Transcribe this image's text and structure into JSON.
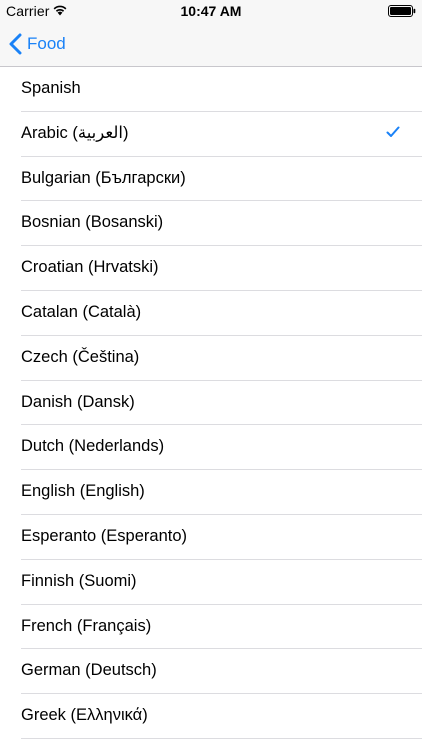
{
  "status_bar": {
    "carrier": "Carrier",
    "time": "10:47 AM",
    "icons": [
      "wifi-icon",
      "battery-icon"
    ]
  },
  "nav": {
    "back_label": "Food",
    "back_icon": "chevron-left-icon"
  },
  "colors": {
    "accent": "#1a82f7",
    "bar_background": "#f7f7f7",
    "separator": "#dcdce0"
  },
  "languages": [
    {
      "label": "Spanish",
      "selected": false
    },
    {
      "label": "Arabic (العربية)",
      "selected": true
    },
    {
      "label": "Bulgarian (Български)",
      "selected": false
    },
    {
      "label": "Bosnian (Bosanski)",
      "selected": false
    },
    {
      "label": "Croatian (Hrvatski)",
      "selected": false
    },
    {
      "label": "Catalan (Català)",
      "selected": false
    },
    {
      "label": "Czech (Čeština)",
      "selected": false
    },
    {
      "label": "Danish (Dansk)",
      "selected": false
    },
    {
      "label": "Dutch (Nederlands)",
      "selected": false
    },
    {
      "label": "English (English)",
      "selected": false
    },
    {
      "label": "Esperanto (Esperanto)",
      "selected": false
    },
    {
      "label": "Finnish (Suomi)",
      "selected": false
    },
    {
      "label": "French (Français)",
      "selected": false
    },
    {
      "label": "German (Deutsch)",
      "selected": false
    },
    {
      "label": "Greek (Ελληνικά)",
      "selected": false
    }
  ]
}
